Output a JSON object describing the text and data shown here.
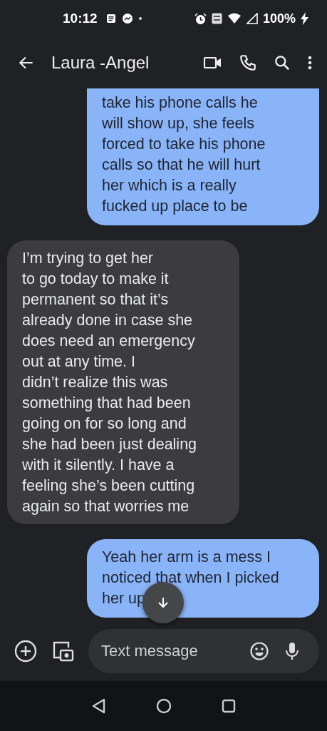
{
  "status_bar": {
    "time": "10:12",
    "battery": "100%"
  },
  "header": {
    "title": "Laura -Angel"
  },
  "messages": [
    {
      "kind": "sent",
      "text": "take his phone calls he\nwill show up, she feels\nforced to take his phone\ncalls so that he will hurt\nher which is a really\nfucked up place to be",
      "cut": true
    },
    {
      "kind": "received",
      "text": "I’m trying to get her\nto go today to make it\npermanent so  that it’s\nalready done in case she\ndoes need an emergency\nout at any time. I\ndidn’t realize this was\nsomething that had been\ngoing on for so long and\nshe had been just dealing\nwith it silently. I have a\nfeeling she’s been cutting\nagain so that worries me",
      "cut": false
    },
    {
      "kind": "sent",
      "text": "Yeah her arm is a mess I\nnoticed that when I picked\nher up",
      "cut": false
    }
  ],
  "compose": {
    "placeholder": "Text message"
  }
}
